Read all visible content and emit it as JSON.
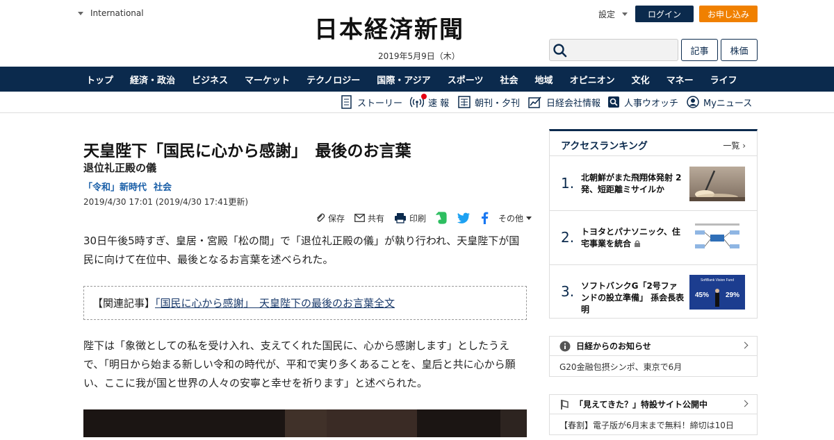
{
  "header": {
    "region": "International",
    "logo": "日本経済新聞",
    "date": "2019年5月9日（木）",
    "settings": "設定",
    "login": "ログイン",
    "apply": "お申し込み",
    "search_placeholder": "",
    "kiji": "記事",
    "kabu": "株価"
  },
  "nav": [
    "トップ",
    "経済・政治",
    "ビジネス",
    "マーケット",
    "テクノロジー",
    "国際・アジア",
    "スポーツ",
    "社会",
    "地域",
    "オピニオン",
    "文化",
    "マネー",
    "ライフ"
  ],
  "subnav": {
    "story": "ストーリー",
    "sokuho": "速 報",
    "choukan": "朝刊・夕刊",
    "company": "日経会社情報",
    "jinji": "人事ウオッチ",
    "mynews": "Myニュース"
  },
  "article": {
    "title": "天皇陛下「国民に心から感謝」　最後のお言葉",
    "subtitle": "退位礼正殿の儀",
    "tags": [
      "「令和」新時代",
      "社会"
    ],
    "date": "2019/4/30 17:01 (2019/4/30 17:41更新)",
    "share": {
      "save": "保存",
      "share": "共有",
      "print": "印刷",
      "other": "その他"
    },
    "para1": "30日午後5時すぎ、皇居・宮殿「松の間」で「退位礼正殿の儀」が執り行われ、天皇陛下が国民に向けて在位中、最後となるお言葉を述べられた。",
    "related_label": "【関連記事】",
    "related_link": "「国民に心から感謝」　天皇陛下の最後のお言葉全文",
    "para2": "陛下は「象徴としての私を受け入れ、支えてくれた国民に、心から感謝します」としたうえで、「明日から始まる新しい令和の時代が、平和で実り多くあることを、皇后と共に心から願い、ここに我が国と世界の人々の安寧と幸せを祈ります」と述べられた。"
  },
  "ranking": {
    "title": "アクセスランキング",
    "all": "一覧",
    "items": [
      {
        "num": "1.",
        "text": "北朝鮮がまた飛翔体発射 2発、短距離ミサイルか"
      },
      {
        "num": "2.",
        "text": "トヨタとパナソニック、住宅事業を統合"
      },
      {
        "num": "3.",
        "text": "ソフトバンクG「2号ファンドの設立準備」 孫会長表明"
      }
    ],
    "thumb3_top": "SoftBank Vision Fund",
    "thumb3_left": "45%",
    "thumb3_right": "29%"
  },
  "notices": [
    {
      "head": "日経からのお知らせ",
      "body": "G20金融包摂シンポ、東京で6月"
    },
    {
      "head": "「見えてきた？」特設サイト公開中",
      "body": "【春割】電子版が6月末まで無料！締切は10日"
    }
  ]
}
